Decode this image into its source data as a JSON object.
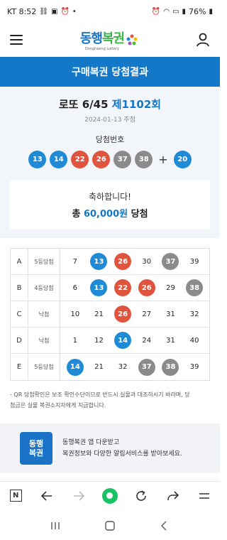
{
  "status_bar": {
    "carrier_time": "KT 8:52",
    "battery": "76%"
  },
  "header": {
    "logo_text_a": "동행",
    "logo_text_b": "복권",
    "logo_sub": "Donghaeng Lottery"
  },
  "title_bar": {
    "title": "구매복권 당첨결과"
  },
  "draw": {
    "name": "로또 6/45",
    "round": "제1102회",
    "date": "2024-01-13 추첨",
    "win_label": "당첨번호",
    "numbers": [
      "13",
      "14",
      "22",
      "26",
      "37",
      "38"
    ],
    "plus": "+",
    "bonus": "20"
  },
  "congrats": {
    "message": "축하합니다!",
    "prefix": "총",
    "amount": "60,000원",
    "suffix": "당첨"
  },
  "results": [
    {
      "letter": "A",
      "rank": "5등당첨",
      "nums": [
        "7",
        "13",
        "26",
        "30",
        "37",
        "39"
      ]
    },
    {
      "letter": "B",
      "rank": "4등당첨",
      "nums": [
        "6",
        "13",
        "22",
        "26",
        "29",
        "38"
      ]
    },
    {
      "letter": "C",
      "rank": "낙첨",
      "nums": [
        "10",
        "21",
        "26",
        "27",
        "31",
        "32"
      ]
    },
    {
      "letter": "D",
      "rank": "낙첨",
      "nums": [
        "1",
        "12",
        "14",
        "24",
        "31",
        "40"
      ]
    },
    {
      "letter": "E",
      "rank": "5등당첨",
      "nums": [
        "14",
        "21",
        "32",
        "37",
        "38",
        "39"
      ]
    }
  ],
  "notice": {
    "line1": "- QR 당첨확인은 보조 확인수단이므로 반드시 실물과 대조하시기 바라며, 당",
    "line2": "첨금은 실물 복권소지자에게 지급합니다."
  },
  "banner": {
    "logo_a": "동행",
    "logo_b": "복권",
    "line1": "동행복권 앱 다운받고",
    "line2": "복권정보와 다양한 알림서비스를 받아보세요."
  },
  "browser": {
    "n_label": "N"
  },
  "colors": {
    "primary": "#1478c8",
    "ball_blue": "#1f8ad6",
    "ball_red": "#e0533c",
    "ball_gray": "#8b8b8b",
    "browser_green": "#19c265"
  }
}
